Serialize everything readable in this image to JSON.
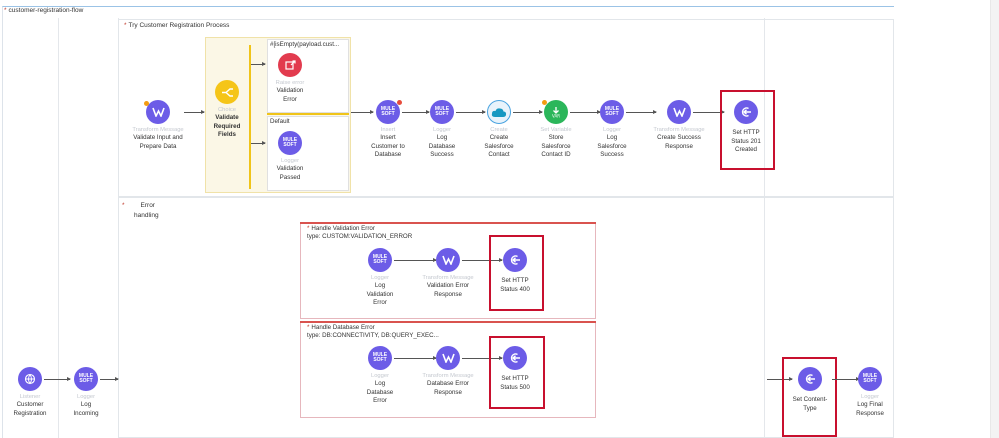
{
  "flow": {
    "title": "customer-registration-flow"
  },
  "try_scope": {
    "title": "Try Customer Registration Process"
  },
  "error_scope": {
    "title_line1": "Error",
    "title_line2": "handling"
  },
  "choice": {
    "when_label": "#[isEmpty(payload.cust...",
    "default_label": "Default"
  },
  "main_nodes": [
    {
      "type": "Transform Message",
      "l1": "Validate Input and",
      "l2": "Prepare Data",
      "l3": ""
    },
    {
      "type": "Choice",
      "l1": "Validate",
      "l2": "Required",
      "l3": "Fields"
    },
    {
      "type": "Raise error",
      "l1": "Validation",
      "l2": "Error",
      "l3": ""
    },
    {
      "type": "Logger",
      "l1": "Validation",
      "l2": "Passed",
      "l3": ""
    },
    {
      "type": "Insert",
      "l1": "Insert",
      "l2": "Customer to",
      "l3": "Database"
    },
    {
      "type": "Logger",
      "l1": "Log",
      "l2": "Database",
      "l3": "Success"
    },
    {
      "type": "Create",
      "l1": "Create",
      "l2": "Salesforce",
      "l3": "Contact"
    },
    {
      "type": "Set Variable",
      "l1": "Store",
      "l2": "Salesforce",
      "l3": "Contact ID"
    },
    {
      "type": "Logger",
      "l1": "Log",
      "l2": "Salesforce",
      "l3": "Success"
    },
    {
      "type": "Transform Message",
      "l1": "Create Success",
      "l2": "Response",
      "l3": ""
    },
    {
      "type": "",
      "l1": "Set HTTP",
      "l2": "Status 201",
      "l3": "Created"
    }
  ],
  "handler1": {
    "title1": "Handle Validation Error",
    "title2": "type: CUSTOM:VALIDATION_ERROR",
    "nodes": [
      {
        "type": "Logger",
        "l1": "Log",
        "l2": "Validation",
        "l3": "Error"
      },
      {
        "type": "Transform Message",
        "l1": "Validation Error",
        "l2": "Response",
        "l3": ""
      },
      {
        "type": "",
        "l1": "Set HTTP",
        "l2": "Status 400",
        "l3": ""
      }
    ]
  },
  "handler2": {
    "title1": "Handle Database Error",
    "title2": "type: DB:CONNECTIVITY, DB:QUERY_EXEC...",
    "nodes": [
      {
        "type": "Logger",
        "l1": "Log",
        "l2": "Database",
        "l3": "Error"
      },
      {
        "type": "Transform Message",
        "l1": "Database Error",
        "l2": "Response",
        "l3": ""
      },
      {
        "type": "",
        "l1": "Set HTTP",
        "l2": "Status 500",
        "l3": ""
      }
    ]
  },
  "outer_nodes": [
    {
      "type": "Listener",
      "l1": "Customer",
      "l2": "Registration",
      "l3": ""
    },
    {
      "type": "Logger",
      "l1": "Log",
      "l2": "Incoming",
      "l3": ""
    },
    {
      "type": "",
      "l1": "Set Content-",
      "l2": "Type",
      "l3": ""
    },
    {
      "type": "Logger",
      "l1": "Log Final",
      "l2": "Response",
      "l3": ""
    }
  ],
  "icons": {
    "mule": "MULE\nSOFT",
    "transform": "transform-icon",
    "set_payload": "set-payload-icon"
  },
  "colors": {
    "node_blue": "#6c5ce7",
    "highlight": "#c8102e",
    "choice_yellow": "#f5c518",
    "salesforce": "#49a3e0",
    "set_variable": "#2bb65a",
    "raise_error": "#e23b4e"
  }
}
